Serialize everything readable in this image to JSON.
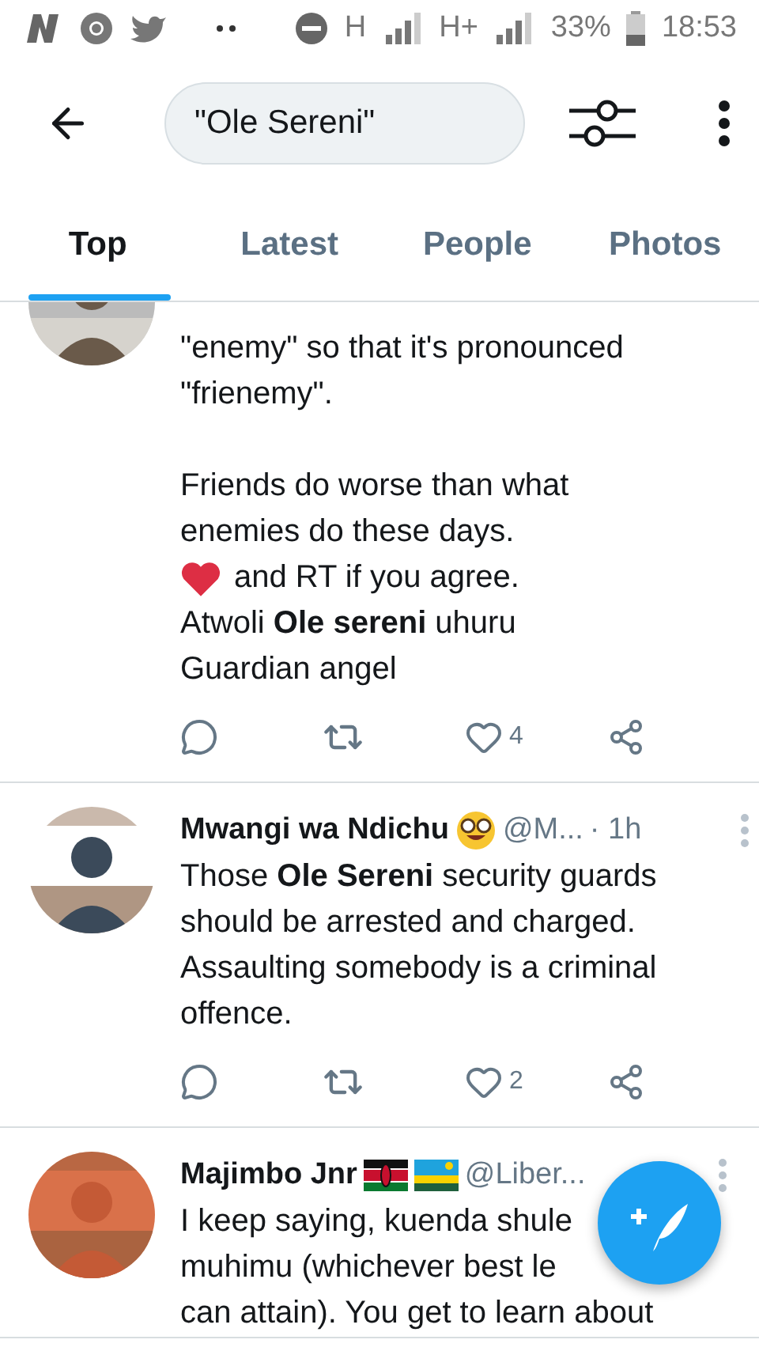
{
  "status_bar": {
    "network_labels": [
      "H",
      "H+"
    ],
    "battery": "33%",
    "time": "18:53"
  },
  "search": {
    "value": "\"Ole Sereni\""
  },
  "tabs": [
    {
      "label": "Top",
      "selected": true
    },
    {
      "label": "Latest",
      "selected": false
    },
    {
      "label": "People",
      "selected": false
    },
    {
      "label": "Photos",
      "selected": false
    }
  ],
  "tweets": [
    {
      "paragraphs": [
        [
          {
            "kind": "line",
            "text": "\"enemy\" so that it's pronounced"
          },
          {
            "kind": "line",
            "text": "\"frienemy\"."
          }
        ],
        [
          {
            "kind": "line",
            "text": "Friends do worse than what"
          },
          {
            "kind": "line",
            "text": "enemies do these days."
          },
          {
            "kind": "heart_line",
            "text": "and RT if you agree."
          },
          {
            "kind": "line",
            "text": "Atwoli  **Ole sereni**  uhuru"
          },
          {
            "kind": "line",
            "text": "Guardian angel"
          }
        ]
      ],
      "likes": "4"
    },
    {
      "author": "Mwangi wa Ndichu",
      "badges": [
        {
          "kind": "nerd"
        }
      ],
      "handle": "@M...",
      "time": "· 1h",
      "paragraphs": [
        [
          {
            "kind": "line",
            "text": "Those **Ole Sereni** security guards"
          },
          {
            "kind": "line",
            "text": "should be arrested and charged."
          },
          {
            "kind": "line",
            "text": "Assaulting somebody is a criminal"
          },
          {
            "kind": "line",
            "text": "offence."
          }
        ]
      ],
      "likes": "2"
    },
    {
      "author": "Majimbo Jnr",
      "badges": [
        {
          "kind": "kenya"
        },
        {
          "kind": "rwanda"
        }
      ],
      "handle": "@Liber...",
      "paragraphs": [
        [
          {
            "kind": "line",
            "text": "I keep saying, kuenda shule"
          },
          {
            "kind": "line",
            "text": "muhimu (whichever best le"
          },
          {
            "kind": "line",
            "text": "can attain). You get to learn about"
          }
        ]
      ]
    }
  ]
}
